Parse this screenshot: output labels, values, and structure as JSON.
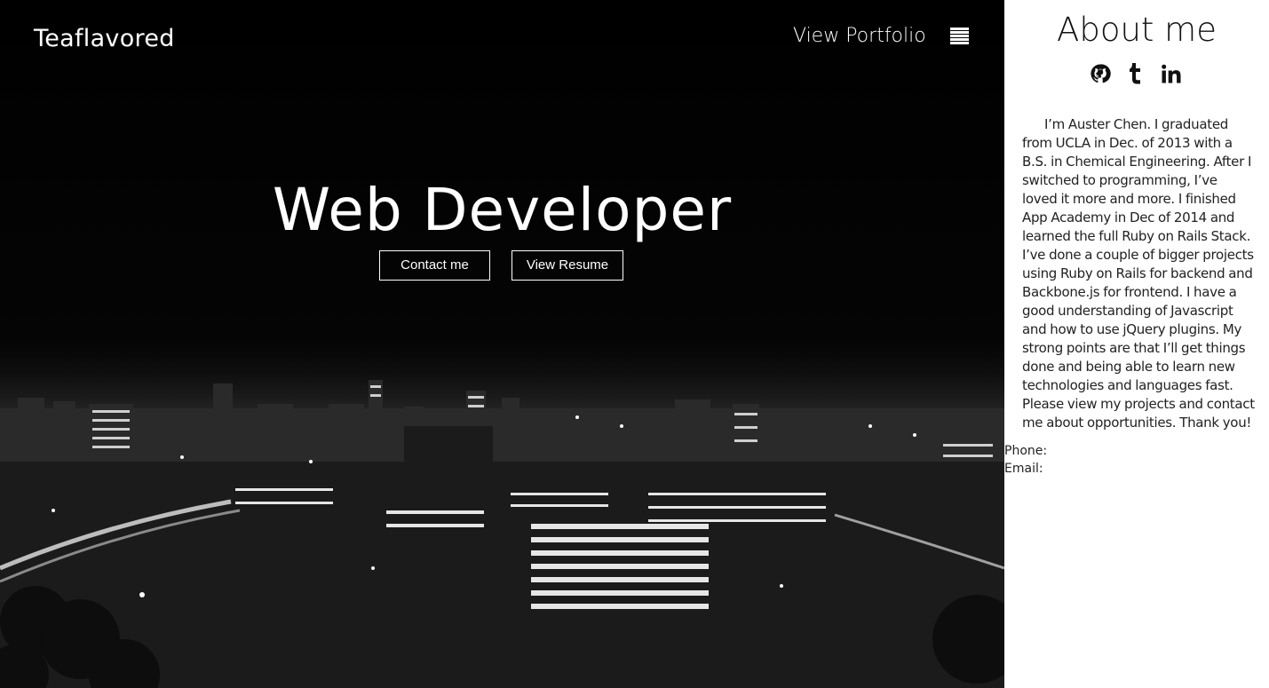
{
  "header": {
    "brand": "Teaflavored",
    "nav_link": "View Portfolio",
    "menu_icon": "hamburger-menu-icon"
  },
  "hero": {
    "headline": "Web Developer",
    "contact_button": "Contact me",
    "resume_button": "View Resume",
    "background": "night-city-skyline-black-and-white"
  },
  "sidebar": {
    "title": "About me",
    "social": [
      {
        "icon": "github-icon"
      },
      {
        "icon": "tumblr-icon"
      },
      {
        "icon": "linkedin-icon"
      }
    ],
    "about": "I’m Auster Chen. I graduated from UCLA in Dec. of 2013 with a B.S. in Chemical Engineering. After I switched to programming, I’ve loved it more and more. I finished App Academy in Dec of 2014 and learned the full Ruby on Rails Stack. I’ve done a couple of bigger projects using Ruby on Rails for backend and Backbone.js for frontend. I have a good understanding of Javascript and how to use jQuery plugins. My strong points are that I’ll get things done and being able to learn new technologies and languages fast. Please view my projects and contact me about opportunities. Thank you!",
    "phone_label": "Phone:",
    "email_label": "Email:"
  },
  "colors": {
    "hero_background": "#000000",
    "sidebar_background": "#ffffff",
    "text_light": "#ffffff",
    "text_dark": "#111111"
  }
}
